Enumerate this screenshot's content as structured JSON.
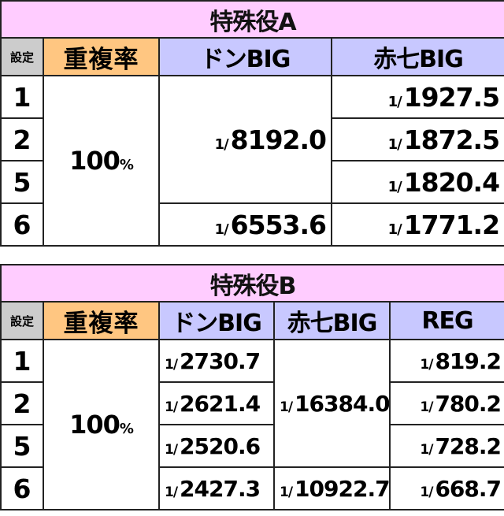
{
  "table_a": {
    "title": "特殊役A",
    "headers": {
      "setting": "設定",
      "dup_rate": "重複率",
      "col1": "ドンBIG",
      "col2": "赤七BIG"
    },
    "dup_rate": {
      "value": "100",
      "unit": "%"
    },
    "don_big": [
      {
        "settings": [
          "1",
          "2",
          "5"
        ],
        "prefix": "1/",
        "value": "8192.0"
      },
      {
        "settings": [
          "6"
        ],
        "prefix": "1/",
        "value": "6553.6"
      }
    ],
    "rows": [
      {
        "setting": "1",
        "aka7_big": {
          "prefix": "1/",
          "value": "1927.5"
        }
      },
      {
        "setting": "2",
        "aka7_big": {
          "prefix": "1/",
          "value": "1872.5"
        }
      },
      {
        "setting": "5",
        "aka7_big": {
          "prefix": "1/",
          "value": "1820.4"
        }
      },
      {
        "setting": "6",
        "aka7_big": {
          "prefix": "1/",
          "value": "1771.2"
        }
      }
    ]
  },
  "table_b": {
    "title": "特殊役B",
    "headers": {
      "setting": "設定",
      "dup_rate": "重複率",
      "col1": "ドンBIG",
      "col2": "赤七BIG",
      "col3": "REG"
    },
    "dup_rate": {
      "value": "100",
      "unit": "%"
    },
    "aka7_big": [
      {
        "settings": [
          "1",
          "2",
          "5"
        ],
        "prefix": "1/",
        "value": "16384.0"
      },
      {
        "settings": [
          "6"
        ],
        "prefix": "1/",
        "value": "10922.7"
      }
    ],
    "rows": [
      {
        "setting": "1",
        "don_big": {
          "prefix": "1/",
          "value": "2730.7"
        },
        "reg": {
          "prefix": "1/",
          "value": "819.2"
        }
      },
      {
        "setting": "2",
        "don_big": {
          "prefix": "1/",
          "value": "2621.4"
        },
        "reg": {
          "prefix": "1/",
          "value": "780.2"
        }
      },
      {
        "setting": "5",
        "don_big": {
          "prefix": "1/",
          "value": "2520.6"
        },
        "reg": {
          "prefix": "1/",
          "value": "728.2"
        }
      },
      {
        "setting": "6",
        "don_big": {
          "prefix": "1/",
          "value": "2427.3"
        },
        "reg": {
          "prefix": "1/",
          "value": "668.7"
        }
      }
    ]
  }
}
